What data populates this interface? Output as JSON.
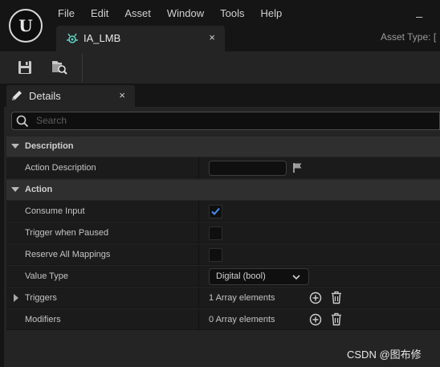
{
  "app": {
    "logo_glyph": "U",
    "menu": [
      "File",
      "Edit",
      "Asset",
      "Window",
      "Tools",
      "Help"
    ],
    "minimize_glyph": "_"
  },
  "asset_tab": {
    "label": "IA_LMB",
    "close_glyph": "×",
    "icon": "input-action-icon"
  },
  "asset_type_label": "Asset Type: [",
  "toolbar": {
    "buttons": [
      "save-icon",
      "browse-to-asset-icon"
    ]
  },
  "details": {
    "tab_label": "Details",
    "close_glyph": "×",
    "search_placeholder": "Search",
    "categories": {
      "description": {
        "title": "Description",
        "rows": {
          "action_description": {
            "label": "Action Description",
            "value": ""
          }
        }
      },
      "action": {
        "title": "Action",
        "rows": {
          "consume_input": {
            "label": "Consume Input",
            "checked": true
          },
          "trigger_when_paused": {
            "label": "Trigger when Paused",
            "checked": false
          },
          "reserve_all_mappings": {
            "label": "Reserve All Mappings",
            "checked": false
          },
          "value_type": {
            "label": "Value Type",
            "value": "Digital (bool)"
          },
          "triggers": {
            "label": "Triggers",
            "value": "1 Array elements"
          },
          "modifiers": {
            "label": "Modifiers",
            "value": "0 Array elements"
          }
        }
      }
    }
  },
  "colors": {
    "accent_check": "#4a8df0",
    "tab_icon": "#5fd0c0"
  },
  "watermark": "CSDN @图布修"
}
